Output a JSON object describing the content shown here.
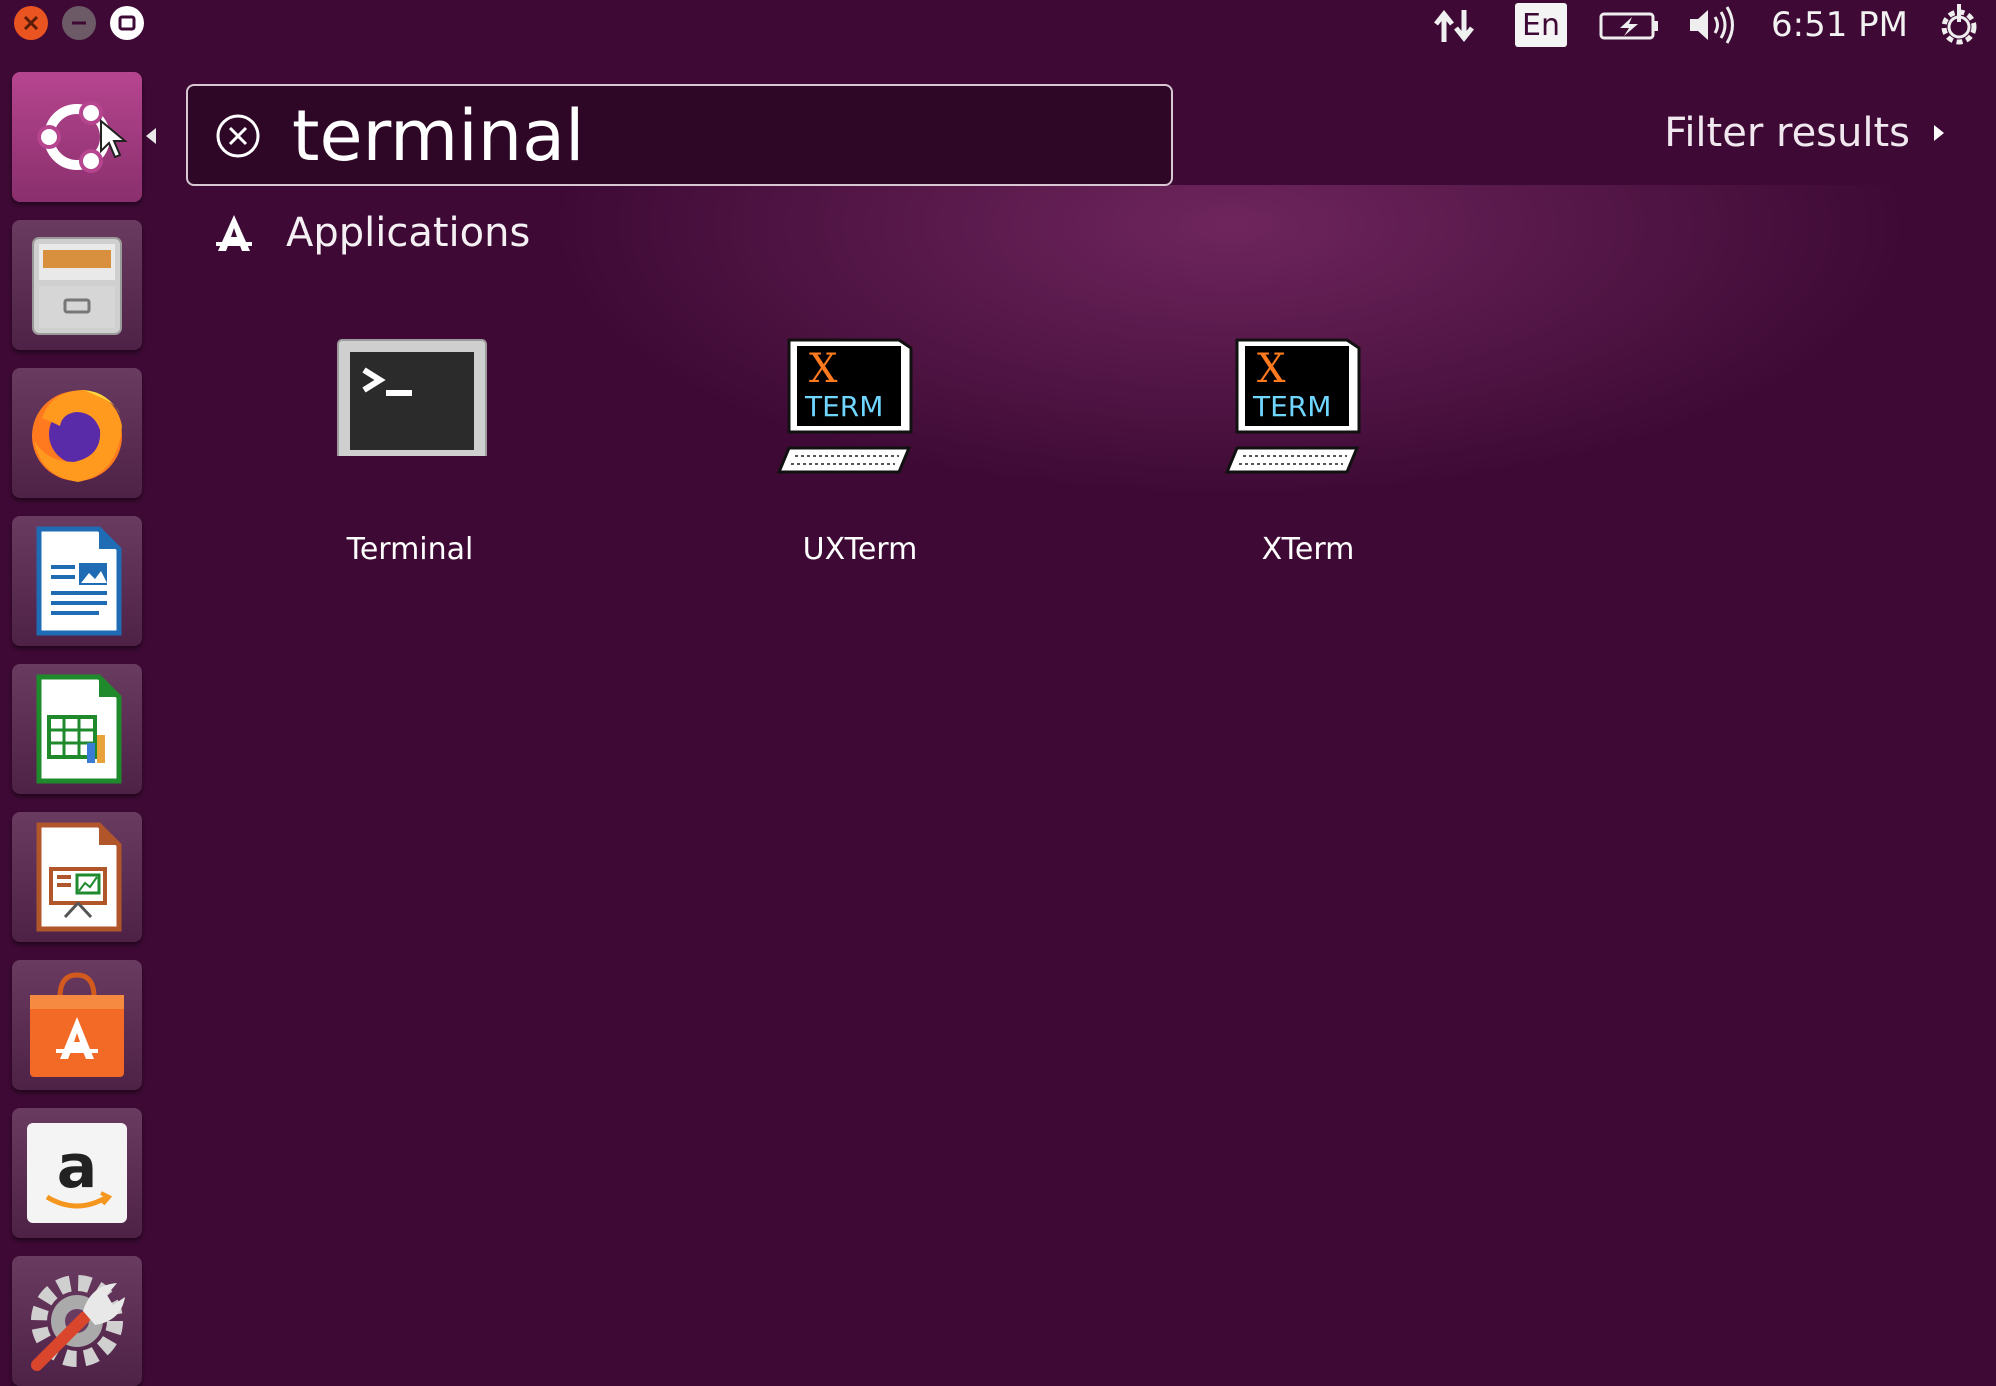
{
  "topbar": {
    "language_indicator": "En",
    "clock": "6:51 PM",
    "icons": [
      "network-updown-icon",
      "keyboard-language-icon",
      "battery-charging-icon",
      "volume-icon",
      "power-gear-icon"
    ]
  },
  "launcher": {
    "items": [
      {
        "name": "ubuntu-dash",
        "icon": "ubuntu-logo-icon"
      },
      {
        "name": "files",
        "icon": "file-cabinet-icon"
      },
      {
        "name": "firefox",
        "icon": "firefox-icon"
      },
      {
        "name": "libreoffice-writer",
        "icon": "writer-document-icon"
      },
      {
        "name": "libreoffice-calc",
        "icon": "calc-spreadsheet-icon"
      },
      {
        "name": "libreoffice-impress",
        "icon": "impress-presentation-icon"
      },
      {
        "name": "ubuntu-software",
        "icon": "software-bag-icon"
      },
      {
        "name": "amazon",
        "icon": "amazon-logo-icon"
      },
      {
        "name": "system-settings",
        "icon": "settings-wrench-gear-icon"
      }
    ]
  },
  "search": {
    "value": "terminal",
    "placeholder": ""
  },
  "filter": {
    "label": "Filter results"
  },
  "section": {
    "title": "Applications"
  },
  "results": [
    {
      "label": "Terminal",
      "icon": "terminal-icon"
    },
    {
      "label": "UXTerm",
      "icon": "xterm-icon",
      "icon_text_x": "X",
      "icon_text_term": "TERM"
    },
    {
      "label": "XTerm",
      "icon": "xterm-icon",
      "icon_text_x": "X",
      "icon_text_term": "TERM"
    }
  ],
  "colors": {
    "background": "#3e0a35",
    "accent": "#e95420",
    "search_bg": "#2e0726"
  }
}
